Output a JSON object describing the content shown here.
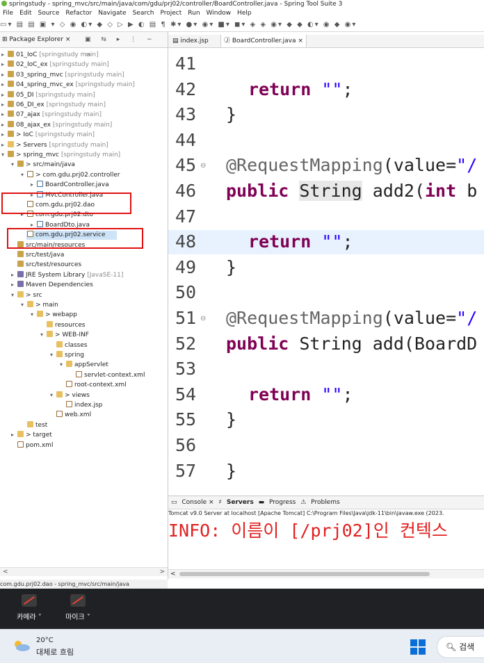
{
  "window": {
    "title": "springstudy - spring_mvc/src/main/java/com/gdu/prj02/controller/BoardController.java - Spring Tool Suite 3"
  },
  "menu": [
    "File",
    "Edit",
    "Source",
    "Refactor",
    "Navigate",
    "Search",
    "Project",
    "Run",
    "Window",
    "Help"
  ],
  "toolbar_glyphs": "▭▾ ▤ ▤ ▣ ▾ ◇ ◉ ◐▾ ◆ ◇ ▷ ▶ ◐ ▤ ¶ ✱▾ ●▾ ◉▾ ■▾ ◼▾ ◈ ◈ ◉▾ ◆ ◆ ◐▾ ◉ ◆ ◉▾",
  "package_explorer": {
    "tab_label": "Package Explorer",
    "items": [
      {
        "label": "01_IoC",
        "decoration": "[springstudy main]"
      },
      {
        "label": "02_IoC_ex",
        "decoration": "[springstudy main]"
      },
      {
        "label": "03_spring_mvc",
        "decoration": "[springstudy main]"
      },
      {
        "label": "04_spring_mvc_ex",
        "decoration": "[springstudy main]"
      },
      {
        "label": "05_DI",
        "decoration": "[springstudy main]"
      },
      {
        "label": "06_DI_ex",
        "decoration": "[springstudy main]"
      },
      {
        "label": "07_ajax",
        "decoration": "[springstudy main]"
      },
      {
        "label": "08_ajax_ex",
        "decoration": "[springstudy main]"
      },
      {
        "label": "> IoC",
        "decoration": "[springstudy main]"
      },
      {
        "label": "> Servers",
        "decoration": "[springstudy main]"
      },
      {
        "label": "> spring_mvc",
        "decoration": "[springstudy main]"
      },
      {
        "label": "> src/main/java",
        "decoration": ""
      },
      {
        "label": "> com.gdu.prj02.controller",
        "decoration": ""
      },
      {
        "label": "BoardController.java",
        "decoration": ""
      },
      {
        "label": "MvcController.java",
        "decoration": ""
      },
      {
        "label": "com.gdu.prj02.dao",
        "decoration": ""
      },
      {
        "label": "com.gdu.prj02.dto",
        "decoration": ""
      },
      {
        "label": "BoardDto.java",
        "decoration": ""
      },
      {
        "label": "com.gdu.prj02.service",
        "decoration": ""
      },
      {
        "label": "src/main/resources",
        "decoration": ""
      },
      {
        "label": "src/test/java",
        "decoration": ""
      },
      {
        "label": "src/test/resources",
        "decoration": ""
      },
      {
        "label": "JRE System Library",
        "decoration": "[JavaSE-11]"
      },
      {
        "label": "Maven Dependencies",
        "decoration": ""
      },
      {
        "label": "> src",
        "decoration": ""
      },
      {
        "label": "> main",
        "decoration": ""
      },
      {
        "label": "> webapp",
        "decoration": ""
      },
      {
        "label": "resources",
        "decoration": ""
      },
      {
        "label": "> WEB-INF",
        "decoration": ""
      },
      {
        "label": "classes",
        "decoration": ""
      },
      {
        "label": "spring",
        "decoration": ""
      },
      {
        "label": "appServlet",
        "decoration": ""
      },
      {
        "label": "servlet-context.xml",
        "decoration": ""
      },
      {
        "label": "root-context.xml",
        "decoration": ""
      },
      {
        "label": "> views",
        "decoration": ""
      },
      {
        "label": "index.jsp",
        "decoration": ""
      },
      {
        "label": "web.xml",
        "decoration": ""
      },
      {
        "label": "test",
        "decoration": ""
      },
      {
        "label": "> target",
        "decoration": ""
      },
      {
        "label": "pom.xml",
        "decoration": ""
      }
    ],
    "status": "com.gdu.prj02.dao - spring_mvc/src/main/java"
  },
  "editor": {
    "tabs": [
      {
        "label": "index.jsp"
      },
      {
        "label": "BoardController.java"
      }
    ],
    "lines": [
      {
        "n": "41",
        "text": ""
      },
      {
        "n": "42",
        "text": "return \"\";"
      },
      {
        "n": "43",
        "text": "}"
      },
      {
        "n": "44",
        "text": ""
      },
      {
        "n": "45",
        "text": "@RequestMapping(value=\"/"
      },
      {
        "n": "46",
        "text": "public String add2(int b"
      },
      {
        "n": "47",
        "text": ""
      },
      {
        "n": "48",
        "text": "return \"\";"
      },
      {
        "n": "49",
        "text": "}"
      },
      {
        "n": "50",
        "text": ""
      },
      {
        "n": "51",
        "text": "@RequestMapping(value=\"/"
      },
      {
        "n": "52",
        "text": "public String add(BoardD"
      },
      {
        "n": "53",
        "text": ""
      },
      {
        "n": "54",
        "text": "return \"\";"
      },
      {
        "n": "55",
        "text": "}"
      },
      {
        "n": "56",
        "text": ""
      },
      {
        "n": "57",
        "text": "}"
      }
    ]
  },
  "console": {
    "tabs": [
      "Console",
      "Servers",
      "Progress",
      "Problems"
    ],
    "header": "Tomcat v9.0 Server at localhost [Apache Tomcat] C:\\Program Files\\Java\\jdk-11\\bin\\javaw.exe  (2023.",
    "line": "INFO: 이름이 [/prj02]인 컨텍스"
  },
  "meeting": {
    "camera_label": "카메라",
    "mic_label": "마이크"
  },
  "taskbar": {
    "temperature": "20°C",
    "weather": "대체로 흐림",
    "search_label": "검색"
  },
  "colors": {
    "keyword": "#7f0055",
    "string": "#2a00ff",
    "annotation": "#646464",
    "console_error": "#e02020",
    "red_box": "#e01010",
    "selection": "#cde3f7"
  }
}
